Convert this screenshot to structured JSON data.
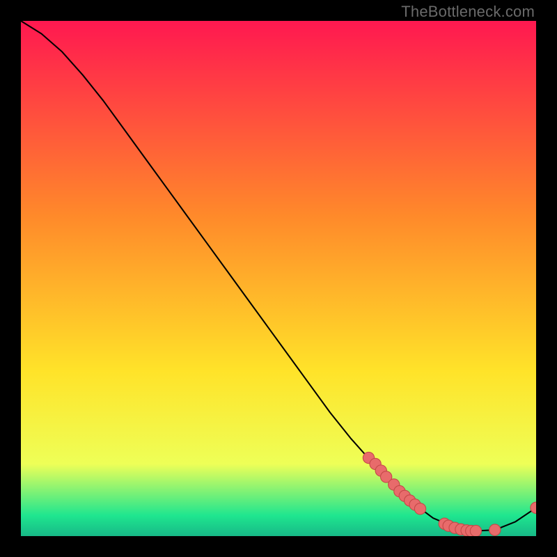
{
  "watermark": "TheBottleneck.com",
  "colors": {
    "line": "#000000",
    "marker_fill": "#e86b6b",
    "marker_stroke": "#c44848",
    "grad_top": "#ff1850",
    "grad_mid1": "#ff8a2a",
    "grad_mid2": "#ffe329",
    "grad_low_y": "#eeff57",
    "grad_mint": "#1fe68f",
    "grad_teal": "#17b987"
  },
  "chart_data": {
    "type": "line",
    "title": "",
    "xlabel": "",
    "ylabel": "",
    "xlim": [
      0,
      100
    ],
    "ylim": [
      0,
      100
    ],
    "series": [
      {
        "name": "curve",
        "x": [
          0,
          4,
          8,
          12,
          16,
          20,
          24,
          28,
          32,
          36,
          40,
          44,
          48,
          52,
          56,
          60,
          64,
          68,
          72,
          76,
          80,
          84,
          88,
          92,
          96,
          100
        ],
        "y": [
          100,
          97.5,
          94,
          89.5,
          84.5,
          79,
          73.5,
          68,
          62.5,
          57,
          51.5,
          46,
          40.5,
          35,
          29.5,
          24,
          19,
          14.5,
          10,
          6.5,
          3.5,
          1.8,
          1.0,
          1.2,
          2.8,
          5.5
        ]
      }
    ],
    "markers": [
      {
        "x": 67.5,
        "y": 15.2
      },
      {
        "x": 68.8,
        "y": 14.0
      },
      {
        "x": 69.9,
        "y": 12.7
      },
      {
        "x": 70.9,
        "y": 11.5
      },
      {
        "x": 72.4,
        "y": 10.0
      },
      {
        "x": 73.5,
        "y": 8.7
      },
      {
        "x": 74.5,
        "y": 7.8
      },
      {
        "x": 75.5,
        "y": 6.9
      },
      {
        "x": 76.5,
        "y": 6.1
      },
      {
        "x": 77.5,
        "y": 5.3
      },
      {
        "x": 82.2,
        "y": 2.4
      },
      {
        "x": 83.0,
        "y": 2.0
      },
      {
        "x": 84.2,
        "y": 1.6
      },
      {
        "x": 85.4,
        "y": 1.3
      },
      {
        "x": 86.5,
        "y": 1.1
      },
      {
        "x": 87.4,
        "y": 1.0
      },
      {
        "x": 88.3,
        "y": 1.0
      },
      {
        "x": 92.0,
        "y": 1.2
      },
      {
        "x": 100.0,
        "y": 5.5
      }
    ],
    "marker_radius": 1.1,
    "line_width": 0.28
  }
}
